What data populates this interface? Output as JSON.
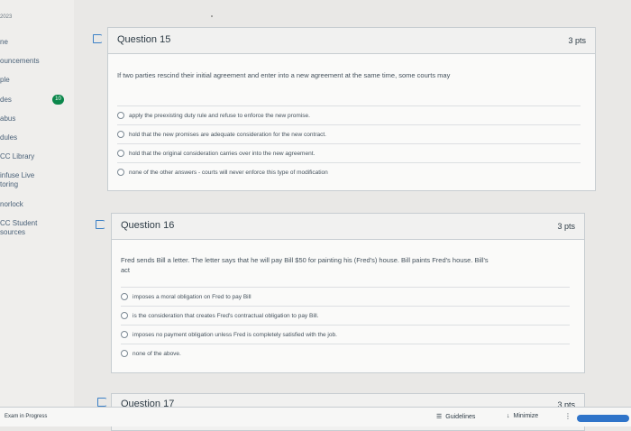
{
  "sidebar": {
    "year": "2023",
    "items": [
      {
        "label": "ne"
      },
      {
        "label": "ouncements"
      },
      {
        "label": "ple"
      },
      {
        "label": "des",
        "badge": "10"
      },
      {
        "label": "abus"
      },
      {
        "label": "dules"
      },
      {
        "label": "CC Library"
      },
      {
        "label": "infuse Live",
        "sub": "toring"
      },
      {
        "label": "norlock"
      },
      {
        "label": "CC Student",
        "sub": "sources"
      }
    ]
  },
  "questions": [
    {
      "title": "Question 15",
      "points": "3 pts",
      "text": "If two parties rescind their initial agreement and enter into a new agreement at the same time, some courts may",
      "answers": [
        "apply the preexisting duty rule and refuse to enforce the new promise.",
        "hold that the new promises are adequate consideration for the new contract.",
        "hold that the original consideration carries over into the new agreement.",
        "none of the other answers - courts will never enforce this type of modification"
      ]
    },
    {
      "title": "Question 16",
      "points": "3 pts",
      "text": "Fred sends Bill a letter. The letter says that he will pay Bill $50 for painting his (Fred's) house. Bill paints Fred's house. Bill's act",
      "answers": [
        "imposes a moral obligation on Fred to pay Bill",
        "is the consideration that creates Fred's contractual obligation to pay Bill.",
        "imposes no payment obligation unless Fred is completely satisfied with the job.",
        "none of the above."
      ]
    },
    {
      "title": "Question 17",
      "points": "3 pts"
    }
  ],
  "footer": {
    "status": "Exam in Progress",
    "guidelines": "Guidelines",
    "minimize": "Minimize"
  }
}
